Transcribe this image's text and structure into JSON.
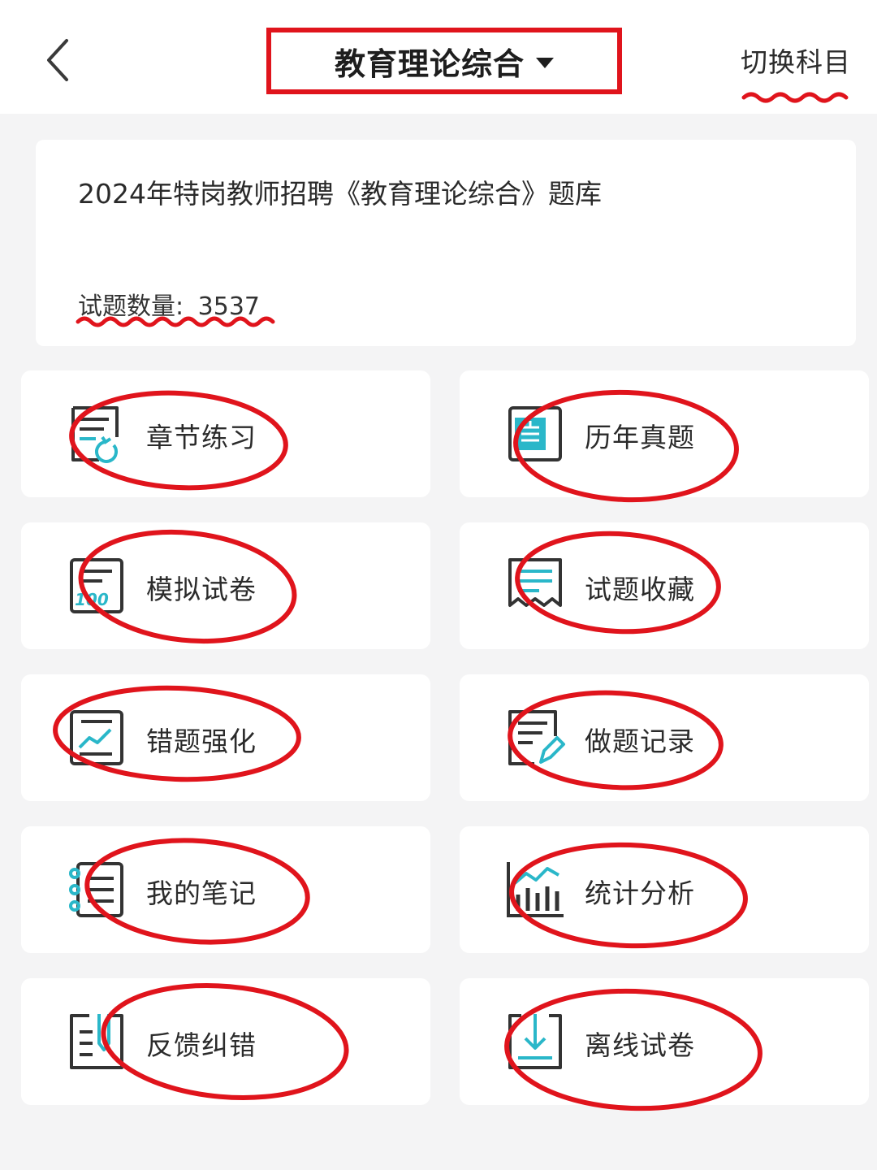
{
  "header": {
    "back_icon": "chevron-left-icon",
    "title": "教育理论综合",
    "switch_label": "切换科目"
  },
  "bank": {
    "title": "2024年特岗教师招聘《教育理论综合》题库",
    "count_label": "试题数量:",
    "count_value": "3537"
  },
  "menu": [
    {
      "label": "章节练习",
      "icon": "chapter-practice-icon"
    },
    {
      "label": "历年真题",
      "icon": "past-exam-icon"
    },
    {
      "label": "模拟试卷",
      "icon": "mock-exam-icon"
    },
    {
      "label": "试题收藏",
      "icon": "favorites-icon"
    },
    {
      "label": "错题强化",
      "icon": "wrong-questions-icon"
    },
    {
      "label": "做题记录",
      "icon": "practice-record-icon"
    },
    {
      "label": "我的笔记",
      "icon": "notes-icon"
    },
    {
      "label": "统计分析",
      "icon": "statistics-icon"
    },
    {
      "label": "反馈纠错",
      "icon": "feedback-icon"
    },
    {
      "label": "离线试卷",
      "icon": "offline-download-icon"
    }
  ],
  "colors": {
    "annotation_red": "#e0141c",
    "icon_dark": "#333333",
    "icon_accent": "#2ab7c9",
    "background": "#f4f4f5"
  }
}
